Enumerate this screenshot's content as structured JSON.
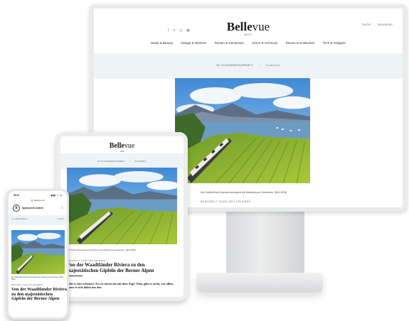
{
  "brand": {
    "logo_bold": "Belle",
    "logo_light": "vue",
    "logo_sub": "NZZ"
  },
  "desktop": {
    "social": "f ✕ ◎ ▣",
    "utility": {
      "search": "Suche",
      "subscribe": "Newsletter"
    },
    "nav": [
      "Mode & Beauty",
      "Design & Wohnen",
      "Reisen & Geniessen",
      "Uhren & Schmuck",
      "Reisen & Entdecken",
      "Tech & Gadgets"
    ],
    "sponsor_label": "IN ZUSAMMENARBEIT",
    "sponsor_brand": "SCHWEIZ",
    "caption": "Der GoldenPass Express durchquert die Weinberg am Genfersee.",
    "caption_credit": "(Bild: BOB)",
    "kicker": "BERGWELT GANZ NEU ERLEBEN"
  },
  "tablet": {
    "sponsor_label": "IN ZUSAMMENARBEIT",
    "sponsor_brand": "SCHWEIZ",
    "caption": "Der GoldenPass Express durchquert die Weinberg am Genfersee. (Bild: BOB)",
    "kicker": "BERGWELT GANZ NEU ERLEBEN",
    "headline": "Von der Waadtländer Riviera zu den majestätischen Gipfeln der Berner Alpen",
    "lead": "Gibt es eine schönere Art zu reisen als mit dem Zug? Nein, gibt es nicht, vor allem wenn es sich dabei um den"
  },
  "phone": {
    "time": "09:41",
    "signal": "▮▮▮ ◠ ▭",
    "url": "🔒 bellevue.ch",
    "avatar_letter": "B",
    "sponsored": "Sponsored Content",
    "menu": "≡",
    "sponsor_label": "IN ZUSAMMENARBEIT",
    "sponsor_brand": "SCHWEIZ",
    "caption": "Der GoldenPass Express durchquert die Weinberg am Genfersee. (Bild: BOB)",
    "kicker": "BERGWELT GANZ NEU ERLEBEN",
    "headline": "Von der Waadtländer Riviera zu den majestätischen Gipfeln der Berner Alpen"
  }
}
